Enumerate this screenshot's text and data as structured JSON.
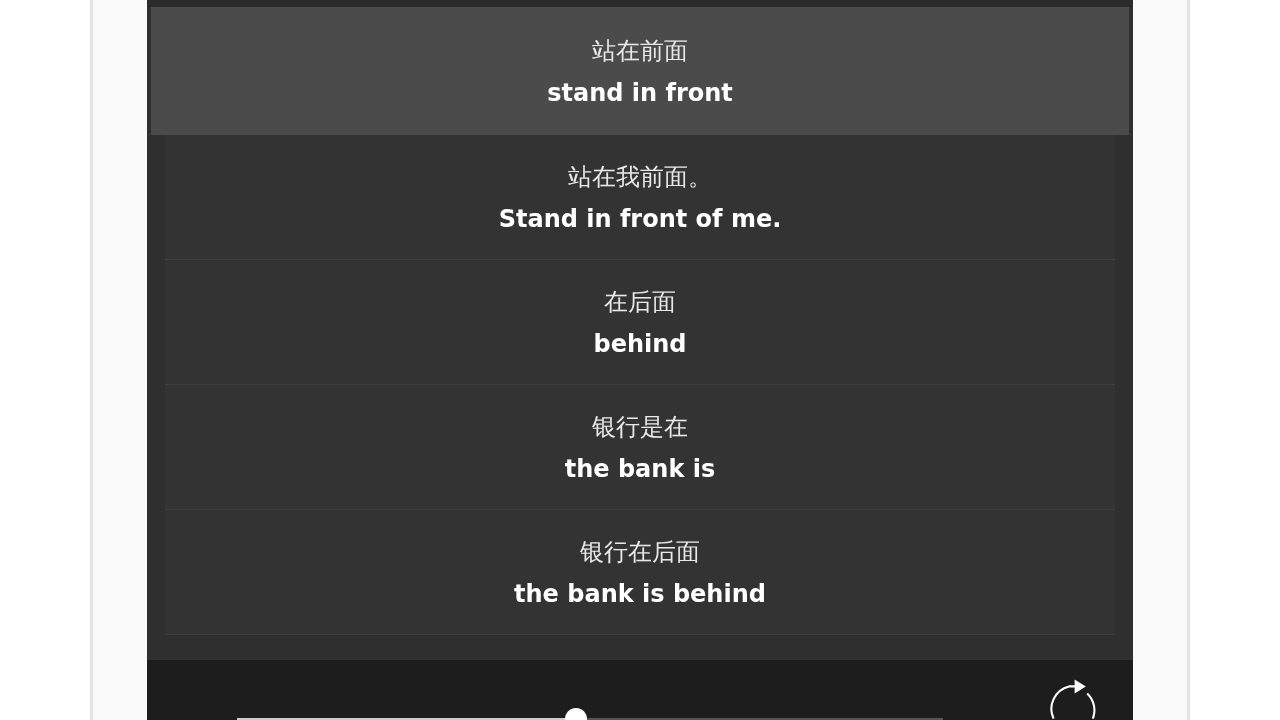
{
  "phrases": [
    {
      "chinese": "站在前面",
      "english": "stand in front",
      "selected": true
    },
    {
      "chinese": "站在我前面。",
      "english": "Stand in front of me.",
      "selected": false
    },
    {
      "chinese": "在后面",
      "english": "behind",
      "selected": false
    },
    {
      "chinese": "银行是在",
      "english": "the bank is",
      "selected": false
    },
    {
      "chinese": "银行在后面",
      "english": "the bank is behind",
      "selected": false
    }
  ],
  "player": {
    "level": 0.48
  }
}
